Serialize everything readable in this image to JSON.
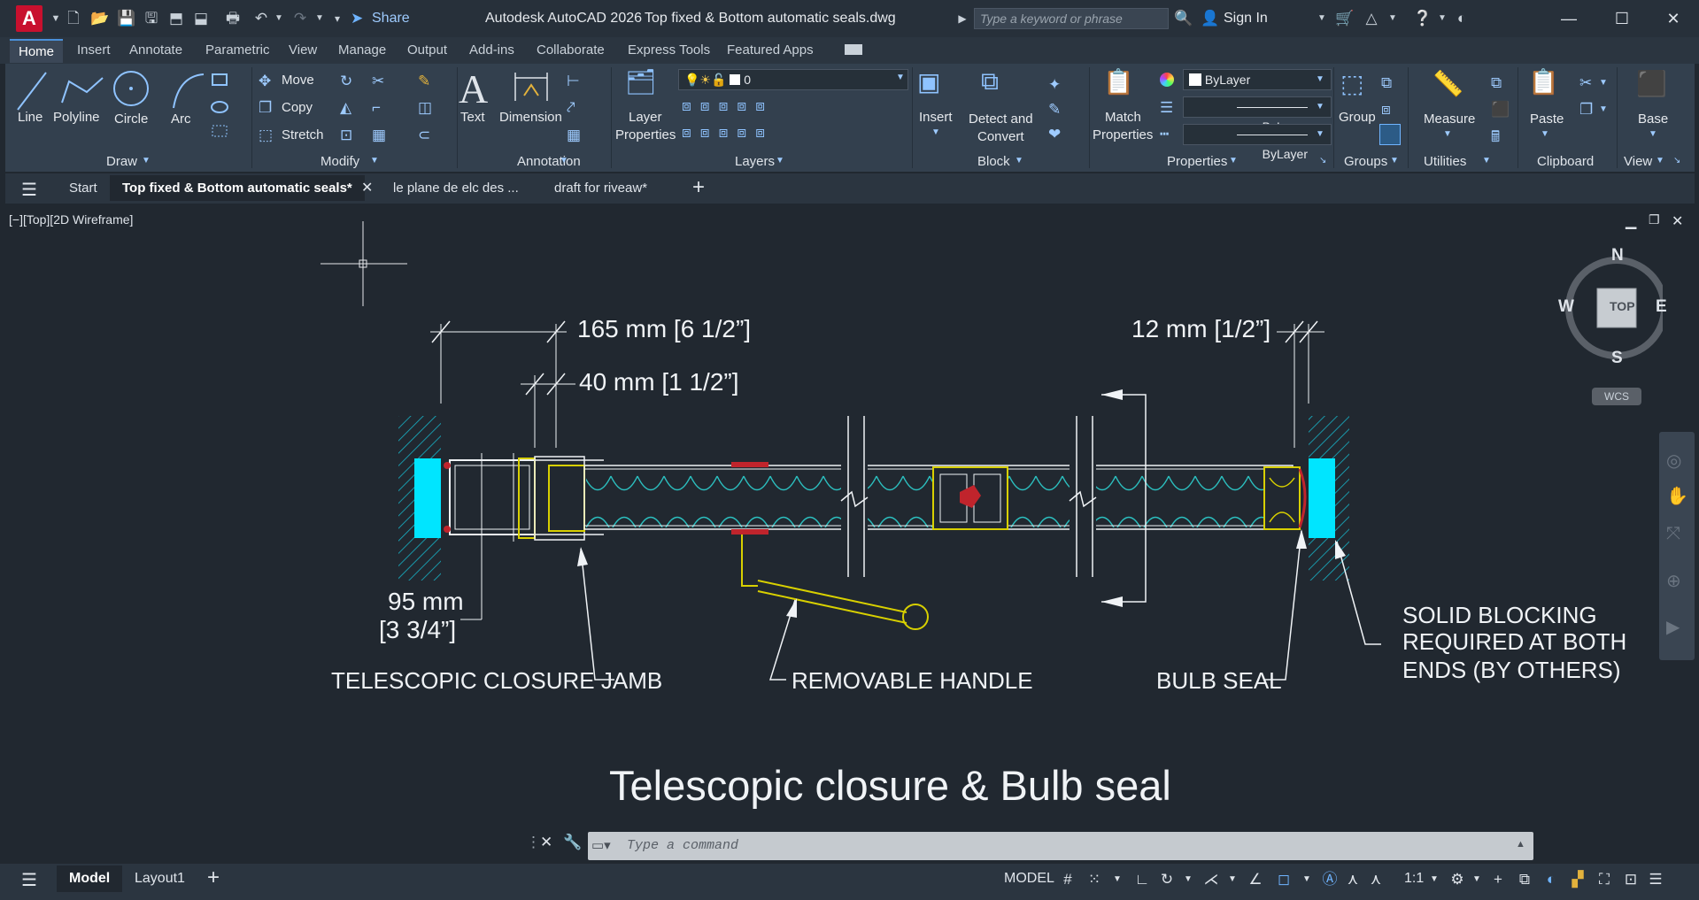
{
  "colors": {
    "accent": "#4a90d9",
    "cyan": "#00e5ff",
    "hatch": "#17b3c7",
    "insul": "#2bc0c0",
    "yellow": "#d8d000",
    "red": "#c0242c",
    "white": "#f0f3f6"
  },
  "titlebar": {
    "app_logo": "A",
    "share": "Share",
    "app_name": "Autodesk AutoCAD 2026",
    "file_name": "Top fixed & Bottom automatic seals.dwg",
    "search_placeholder": "Type a keyword or phrase",
    "sign_in": "Sign In"
  },
  "ribbon_tabs": [
    "Home",
    "Insert",
    "Annotate",
    "Parametric",
    "View",
    "Manage",
    "Output",
    "Add-ins",
    "Collaborate",
    "Express Tools",
    "Featured Apps"
  ],
  "ribbon": {
    "draw": {
      "title": "Draw",
      "line": "Line",
      "polyline": "Polyline",
      "circle": "Circle",
      "arc": "Arc"
    },
    "modify": {
      "title": "Modify",
      "move": "Move",
      "copy": "Copy",
      "stretch": "Stretch"
    },
    "annotation": {
      "title": "Annotation",
      "text": "Text",
      "dimension": "Dimension"
    },
    "layers": {
      "title": "Layers",
      "layer_properties_1": "Layer",
      "layer_properties_2": "Properties",
      "current_layer": "0"
    },
    "block": {
      "title": "Block",
      "insert": "Insert",
      "detect_1": "Detect and",
      "detect_2": "Convert"
    },
    "properties": {
      "title": "Properties",
      "match_1": "Match",
      "match_2": "Properties",
      "color": "ByLayer",
      "linetype": "ByLayer",
      "lineweight": "ByLayer"
    },
    "groups": {
      "title": "Groups",
      "group": "Group"
    },
    "utilities": {
      "title": "Utilities",
      "measure": "Measure"
    },
    "clipboard": {
      "title": "Clipboard",
      "paste": "Paste"
    },
    "view": {
      "title": "View",
      "base": "Base"
    }
  },
  "file_tabs": {
    "start": "Start",
    "tabs": [
      "Top fixed & Bottom automatic seals*",
      "le plane de elc des ...",
      "draft for riveaw*"
    ]
  },
  "viewport": {
    "label": "[−][Top][2D Wireframe]",
    "compass": {
      "n": "N",
      "s": "S",
      "e": "E",
      "w": "W",
      "top": "TOP",
      "wcs": "WCS"
    }
  },
  "drawing": {
    "dim_165": "165 mm [6 1/2”]",
    "dim_40": "40 mm [1 1/2”]",
    "dim_12": "12 mm [1/2”]",
    "dim_95_1": "95 mm",
    "dim_95_2": "[3 3/4”]",
    "label_jamb": "TELESCOPIC CLOSURE JAMB",
    "label_handle": "REMOVABLE HANDLE",
    "label_bulb": "BULB SEAL",
    "label_block_1": "SOLID BLOCKING",
    "label_block_2": "REQUIRED AT BOTH",
    "label_block_3": "ENDS (BY OTHERS)",
    "caption": "Telescopic closure & Bulb seal"
  },
  "command": {
    "placeholder": "Type a command"
  },
  "status": {
    "model_tab": "Model",
    "layout_tab": "Layout1",
    "space": "MODEL",
    "scale": "1:1"
  }
}
